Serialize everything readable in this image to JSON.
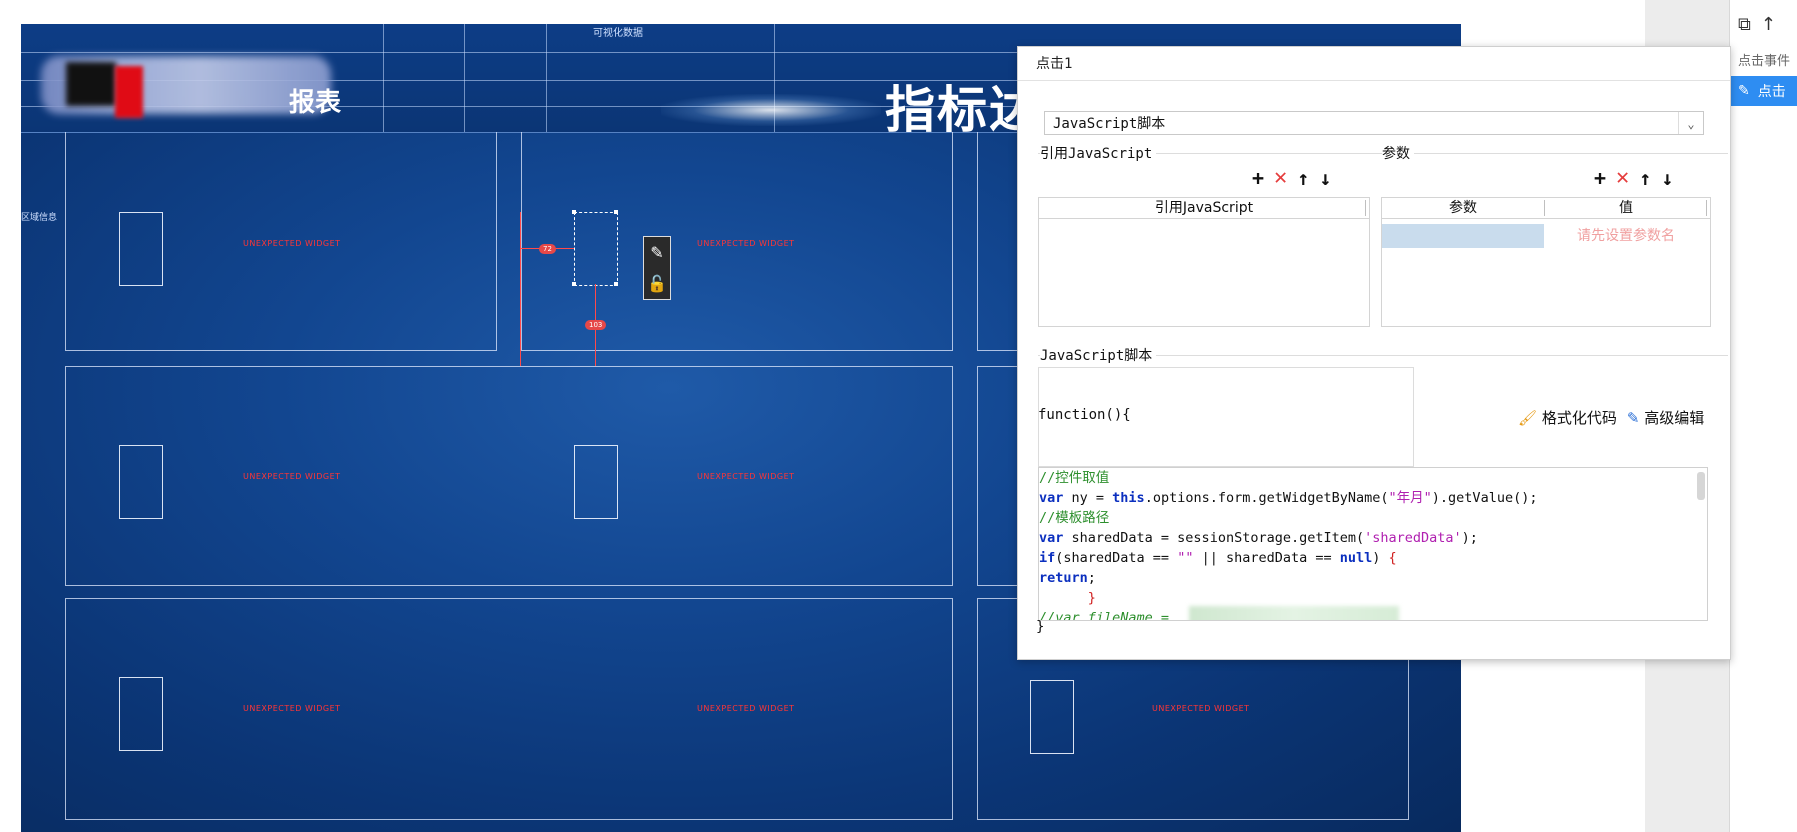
{
  "canvas": {
    "top_tiny_label": "可视化数据",
    "left_tiny_label": "区域信息",
    "logo_text": "报表",
    "main_title": "指标达",
    "widget_error_text": "UNEXPECTED WIDGET",
    "badge_1": "72",
    "badge_2": "103"
  },
  "dialog": {
    "title": "点击1",
    "type_selected": "JavaScript脚本",
    "ref_js_label": "引用JavaScript",
    "params_label": "参数",
    "ref_js_table_header": "引用JavaScript",
    "params_col_name": "参数",
    "params_col_value": "值",
    "param_placeholder": "请先设置参数名",
    "script_label": "JavaScript脚本",
    "function_sig": "function(){",
    "format_code_label": "格式化代码",
    "advanced_edit_label": "高级编辑",
    "code_lines": [
      {
        "cls": "c-com",
        "text": "//控件取值"
      },
      {
        "cls": "mixed1",
        "text": ""
      },
      {
        "cls": "c-com",
        "text": "//模板路径"
      },
      {
        "cls": "mixed2",
        "text": ""
      },
      {
        "cls": "mixed3",
        "text": ""
      },
      {
        "cls": "mixed4",
        "text": ""
      },
      {
        "cls": "c-red",
        "text": "      }"
      },
      {
        "cls": "c-com",
        "text": "//var fileName = "
      }
    ],
    "close_brace": "}"
  },
  "right_panel": {
    "event_label": "点击事件",
    "item_label": "点击"
  },
  "colors": {
    "accent_blue": "#2e8df2",
    "canvas_blue": "#124690",
    "delete_red": "#e53d3d"
  }
}
